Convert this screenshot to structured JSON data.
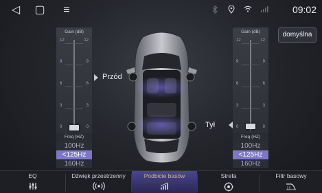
{
  "status_bar": {
    "time": "09:02",
    "nav": {
      "back_icon": "◁",
      "home_icon": "▢",
      "menu_icon": "≡"
    },
    "icons": [
      "bluetooth-icon",
      "location-icon",
      "wifi-icon",
      "signal-icon"
    ]
  },
  "default_button": "domyślna",
  "eq_left": {
    "header": "Gain (dB)",
    "ticks": [
      "12",
      "9",
      "6",
      "3",
      "0"
    ],
    "freq_header": "Freq (HZ)",
    "freq_options": [
      "100Hz",
      "<125Hz",
      "160Hz"
    ],
    "selected_freq": "<125Hz",
    "gain_value": 0
  },
  "eq_right": {
    "header": "Gain (dB)",
    "ticks": [
      "12",
      "9",
      "6",
      "3",
      "0"
    ],
    "freq_header": "Freq (HZ)",
    "freq_options": [
      "100Hz",
      "<125Hz",
      "160Hz"
    ],
    "selected_freq": "<125Hz",
    "gain_value": 0
  },
  "speakers": {
    "front": "Przód",
    "rear": "Tył"
  },
  "tabs": [
    {
      "label": "EQ",
      "icon": "equalizer-icon"
    },
    {
      "label": "Dźwięk przestrzenny",
      "icon": "surround-icon"
    },
    {
      "label": "Podbicie basów",
      "icon": "bass-boost-icon",
      "active": true
    },
    {
      "label": "Strefa",
      "icon": "zone-icon"
    },
    {
      "label": "Filtr basowy",
      "icon": "bass-filter-icon"
    }
  ],
  "colors": {
    "accent": "#7d77c8",
    "active_tab_text": "#c8b98a"
  }
}
